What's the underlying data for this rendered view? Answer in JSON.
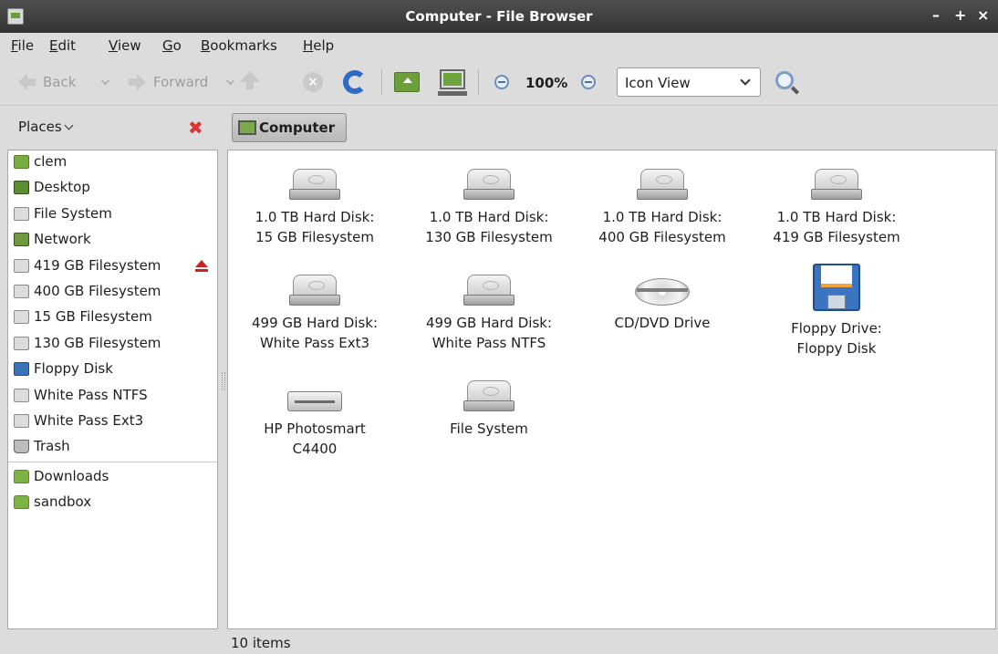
{
  "window": {
    "title": "Computer - File Browser",
    "controls": [
      "–",
      "+",
      "×"
    ]
  },
  "menubar": [
    {
      "label": "File",
      "mnemonic": "F",
      "rest": "ile"
    },
    {
      "label": "Edit",
      "mnemonic": "E",
      "rest": "dit"
    },
    {
      "label": "View",
      "mnemonic": "V",
      "rest": "iew"
    },
    {
      "label": "Go",
      "mnemonic": "G",
      "rest": "o"
    },
    {
      "label": "Bookmarks",
      "mnemonic": "B",
      "rest": "ookmarks"
    },
    {
      "label": "Help",
      "mnemonic": "H",
      "rest": "elp"
    }
  ],
  "toolbar": {
    "back": "Back",
    "forward": "Forward",
    "zoom": "100%",
    "view_mode": "Icon View"
  },
  "sidebar": {
    "header": "Places",
    "items": [
      {
        "label": "clem",
        "icon": "home-folder-icon"
      },
      {
        "label": "Desktop",
        "icon": "desktop-icon"
      },
      {
        "label": "File System",
        "icon": "drive-icon"
      },
      {
        "label": "Network",
        "icon": "network-icon"
      },
      {
        "label": "419 GB Filesystem",
        "icon": "drive-icon",
        "ejectable": true
      },
      {
        "label": "400 GB Filesystem",
        "icon": "drive-icon"
      },
      {
        "label": "15 GB Filesystem",
        "icon": "drive-icon"
      },
      {
        "label": "130 GB Filesystem",
        "icon": "drive-icon"
      },
      {
        "label": "Floppy Disk",
        "icon": "floppy-icon"
      },
      {
        "label": "White Pass NTFS",
        "icon": "drive-icon"
      },
      {
        "label": "White Pass Ext3",
        "icon": "drive-icon"
      },
      {
        "label": "Trash",
        "icon": "trash-icon"
      }
    ],
    "bookmarks": [
      {
        "label": "Downloads",
        "icon": "folder-icon"
      },
      {
        "label": "sandbox",
        "icon": "folder-icon"
      }
    ]
  },
  "pathbar": {
    "current": "Computer"
  },
  "files": [
    {
      "line1": "1.0 TB Hard Disk:",
      "line2": "15 GB Filesystem",
      "icon": "hard-disk-icon"
    },
    {
      "line1": "1.0 TB Hard Disk:",
      "line2": "130 GB Filesystem",
      "icon": "hard-disk-icon"
    },
    {
      "line1": "1.0 TB Hard Disk:",
      "line2": "400 GB Filesystem",
      "icon": "hard-disk-icon"
    },
    {
      "line1": "1.0 TB Hard Disk:",
      "line2": "419 GB Filesystem",
      "icon": "hard-disk-icon"
    },
    {
      "line1": "499 GB Hard Disk:",
      "line2": "White Pass Ext3",
      "icon": "hard-disk-icon"
    },
    {
      "line1": "499 GB Hard Disk:",
      "line2": "White Pass NTFS",
      "icon": "hard-disk-icon"
    },
    {
      "line1": "CD/DVD Drive",
      "line2": "",
      "icon": "cdrom-icon"
    },
    {
      "line1": "Floppy Drive:",
      "line2": "Floppy Disk",
      "icon": "floppy-icon"
    },
    {
      "line1": "HP Photosmart",
      "line2": "C4400",
      "icon": "printer-icon"
    },
    {
      "line1": "File System",
      "line2": "",
      "icon": "hard-disk-icon"
    }
  ],
  "status": {
    "text": "10 items"
  }
}
